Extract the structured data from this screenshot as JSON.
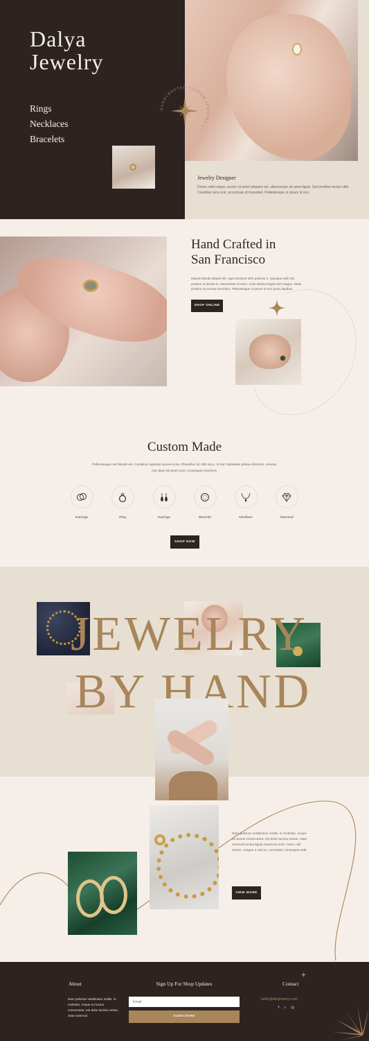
{
  "brand": {
    "line1": "Dalya",
    "line2": "Jewelry"
  },
  "nav": {
    "items": [
      "Rings",
      "Necklaces",
      "Bracelets"
    ]
  },
  "badge": {
    "text": "HANDCRAFTED CUSTOM JEWELRY •"
  },
  "designer": {
    "title": "Jewelry Designer",
    "text": "Donec velit neque, auctor sit amet aliquam vel, ullamcorper sit amet ligula. Sed porttitor lectus nibh. Curabitur arcu erat, accumsan id imperdiet. Pellentesque in ipsum id orci."
  },
  "handcrafted": {
    "title_line1": "Hand Crafted in",
    "title_line2": "San Francisco",
    "text": "Mauris blandit aliquet elit, eget tincidunt nibh pulvinar a. Quisque velit nisi, pretium ut lacinia in, elementum id enim. Cras ultricies ligula sed magna. Nulla porttitor accumsan tincidunt. Pellentesque in ipsum id orci porta dapibus.",
    "button": "SHOP ONLINE"
  },
  "custom": {
    "title": "Custom Made",
    "text": "Pellentesque vel blandit est. Curabitur egestas laoreet urna. Phasellus sit nibh arcu. In hac habitasse platea dictumst. Aenean non diam sit amet nunc consequat maximus.",
    "items": [
      {
        "label": "Earrings",
        "icon": "earrings-rings-icon"
      },
      {
        "label": "Ring",
        "icon": "ring-icon"
      },
      {
        "label": "Earrings",
        "icon": "drop-earrings-icon"
      },
      {
        "label": "Bracelet",
        "icon": "bracelet-icon"
      },
      {
        "label": "Necklace",
        "icon": "necklace-icon"
      },
      {
        "label": "Diamond",
        "icon": "diamond-icon"
      }
    ],
    "button": "SHOP NOW"
  },
  "bighand": {
    "line1": "JEWELRY",
    "line2": "BY HAND"
  },
  "gallery": {
    "text": "Nam pulvinar vestibulum mollis. In molestie, neque eu luctus consectetur, est dolor lacinia metus, vitae euismod lectus ligula maximus enim. Nunc nisl metus, congue a nisl eu, venenatis consequat velit.",
    "button": "VIEW MORE"
  },
  "footer": {
    "about_title": "About",
    "about_text": "Nam pulvinar vestibulum mollis. In molestie, neque eu luctus consectetur, est dolor lacinia metus, vitae euismod",
    "signup_title": "Sign Up For Shop Updates",
    "email_placeholder": "Email",
    "subscribe": "SUBSCRIBE",
    "contact_title": "Contact",
    "email": "hello@divijewelry.com",
    "social": [
      "f",
      "♪",
      "◎"
    ]
  },
  "colors": {
    "dark": "#2d2421",
    "gold": "#a8855a",
    "cream": "#f6efe9",
    "beige": "#e7dfd1"
  }
}
